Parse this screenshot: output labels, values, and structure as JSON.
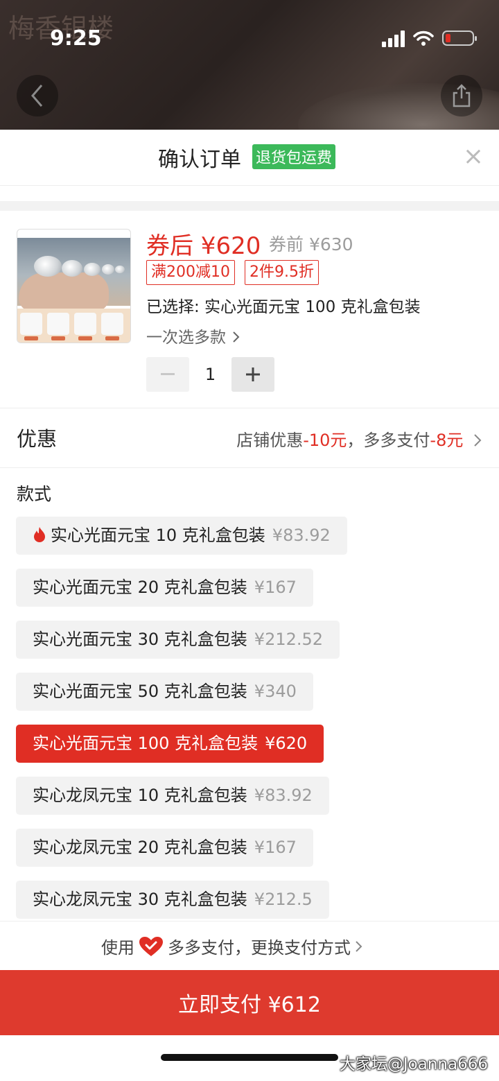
{
  "status_bar": {
    "time": "9:25"
  },
  "background": {
    "shop_name": "梅香银楼"
  },
  "header": {
    "title": "确认订单",
    "tag": "退货包运费",
    "close": "×"
  },
  "product": {
    "price_after": "券后 ¥620",
    "price_before": "券前 ¥630",
    "promos": [
      "满200减10",
      "2件9.5折"
    ],
    "selected": "已选择: 实心光面元宝 100 克礼盒包装",
    "multi_select": "一次选多款",
    "quantity": "1"
  },
  "coupon": {
    "label": "优惠",
    "text1": "店铺优惠",
    "amount1": "-10元",
    "text2": "，多多支付",
    "amount2": "-8元"
  },
  "style_label": "款式",
  "skus": [
    {
      "name": "实心光面元宝 10 克礼盒包装",
      "price": "¥83.92",
      "hot": true,
      "selected": false
    },
    {
      "name": "实心光面元宝 20 克礼盒包装",
      "price": "¥167",
      "hot": false,
      "selected": false
    },
    {
      "name": "实心光面元宝 30 克礼盒包装",
      "price": "¥212.52",
      "hot": false,
      "selected": false
    },
    {
      "name": "实心光面元宝 50 克礼盒包装",
      "price": "¥340",
      "hot": false,
      "selected": false
    },
    {
      "name": "实心光面元宝 100 克礼盒包装",
      "price": "¥620",
      "hot": false,
      "selected": true
    },
    {
      "name": "实心龙凤元宝 10 克礼盒包装",
      "price": "¥83.92",
      "hot": false,
      "selected": false
    },
    {
      "name": "实心龙凤元宝 20 克礼盒包装",
      "price": "¥167",
      "hot": false,
      "selected": false
    },
    {
      "name": "实心龙凤元宝 30 克礼盒包装",
      "price": "¥212.5",
      "hot": false,
      "selected": false
    }
  ],
  "payment": {
    "prefix": "使用",
    "method": "多多支付，更换支付方式",
    "pay_button": "立即支付 ¥612"
  },
  "watermark": "大家坛@Joanna666",
  "colors": {
    "accent": "#e02e24",
    "tag_green": "#3cb95a",
    "pay_button": "#de3a2e"
  }
}
